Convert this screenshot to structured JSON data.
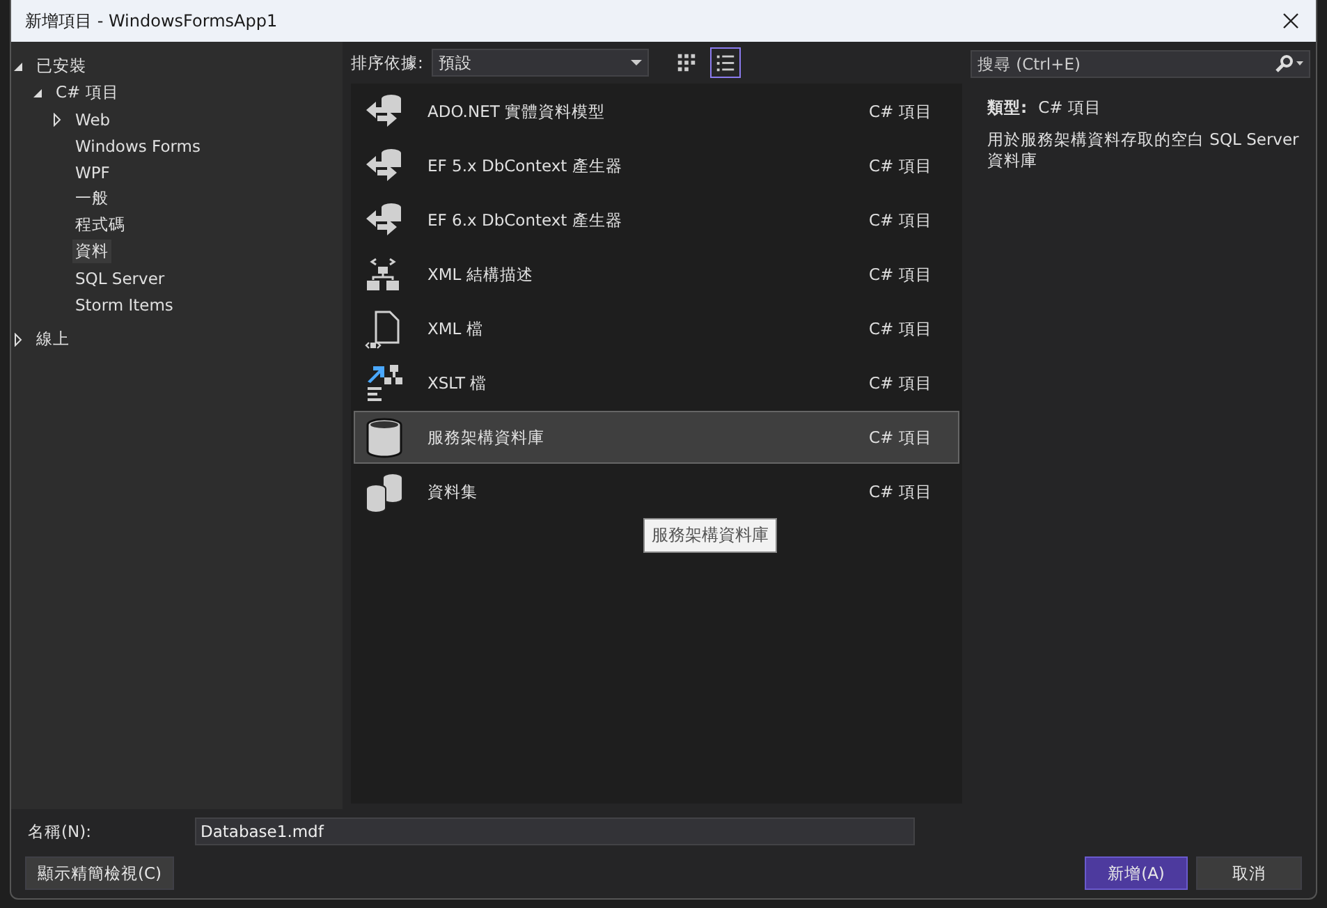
{
  "window": {
    "title": "新增項目 - WindowsFormsApp1"
  },
  "tree": [
    {
      "label": "已安裝",
      "kind": "group",
      "expanded": true,
      "selected": false,
      "children": [
        {
          "label": "C# 項目",
          "kind": "group",
          "expanded": true,
          "selected": false,
          "children": [
            {
              "label": "Web",
              "kind": "group",
              "expanded": false,
              "selected": false
            },
            {
              "label": "Windows Forms",
              "kind": "leaf",
              "selected": false
            },
            {
              "label": "WPF",
              "kind": "leaf",
              "selected": false
            },
            {
              "label": "一般",
              "kind": "leaf",
              "selected": false
            },
            {
              "label": "程式碼",
              "kind": "leaf",
              "selected": false
            },
            {
              "label": "資料",
              "kind": "leaf",
              "selected": true
            },
            {
              "label": "SQL Server",
              "kind": "leaf",
              "selected": false
            },
            {
              "label": "Storm Items",
              "kind": "leaf",
              "selected": false
            }
          ]
        }
      ]
    },
    {
      "label": "線上",
      "kind": "group",
      "expanded": false,
      "selected": false
    }
  ],
  "sort": {
    "label": "排序依據:",
    "value": "預設"
  },
  "view_buttons": [
    {
      "kind": "grid",
      "selected": false
    },
    {
      "kind": "list",
      "selected": true
    }
  ],
  "search": {
    "placeholder": "搜尋 (Ctrl+E)"
  },
  "templates": [
    {
      "name": "ADO.NET 實體資料模型",
      "type": "C# 項目",
      "kind": "entity",
      "selected": false
    },
    {
      "name": "EF 5.x DbContext 產生器",
      "type": "C# 項目",
      "kind": "entity",
      "selected": false
    },
    {
      "name": "EF 6.x DbContext 產生器",
      "type": "C# 項目",
      "kind": "entity",
      "selected": false
    },
    {
      "name": "XML 結構描述",
      "type": "C# 項目",
      "kind": "schema",
      "selected": false
    },
    {
      "name": "XML 檔",
      "type": "C# 項目",
      "kind": "xmlfile",
      "selected": false
    },
    {
      "name": "XSLT 檔",
      "type": "C# 項目",
      "kind": "xslt",
      "selected": false
    },
    {
      "name": "服務架構資料庫",
      "type": "C# 項目",
      "kind": "database",
      "selected": true
    },
    {
      "name": "資料集",
      "type": "C# 項目",
      "kind": "dataset",
      "selected": false
    }
  ],
  "tooltip": "服務架構資料庫",
  "details": {
    "type_label": "類型:",
    "type_value": "C# 項目",
    "description": "用於服務架構資料存取的空白 SQL Server 資料庫"
  },
  "name_field": {
    "label": "名稱(N):",
    "value": "Database1.mdf"
  },
  "buttons": [
    {
      "label": "顯示精簡檢視(C)",
      "kind": "secondary"
    },
    {
      "label": "新增(A)",
      "kind": "primary"
    },
    {
      "label": "取消",
      "kind": "secondary"
    }
  ]
}
